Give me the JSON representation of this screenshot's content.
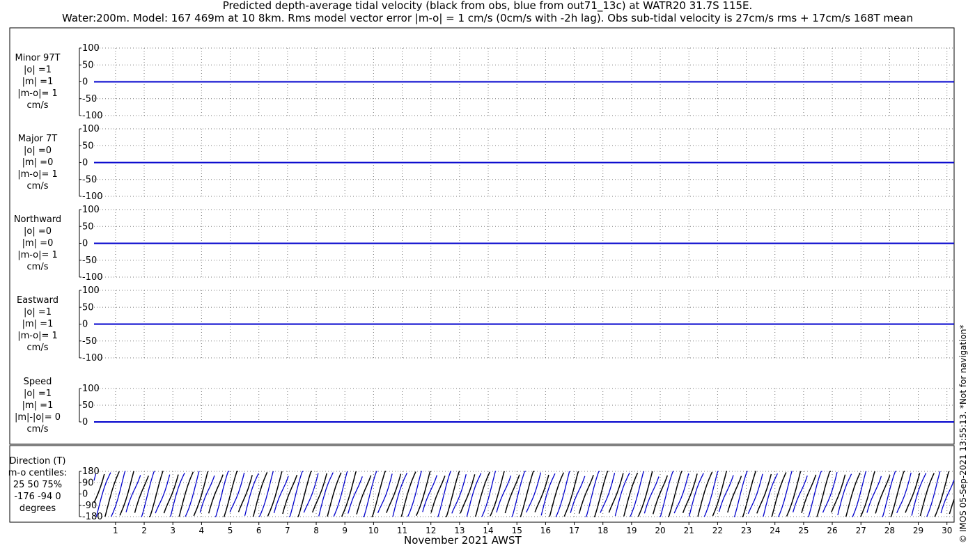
{
  "title": {
    "line1": "Predicted depth-average tidal velocity (black from obs, blue from out71_13c) at WATR20 31.7S 115E.",
    "line2": "Water:200m. Model: 167 469m at 10 8km. Rms model vector error |m-o| = 1 cm/s (0cm/s with -2h lag). Obs sub-tidal velocity is 27cm/s rms + 17cm/s 168T mean"
  },
  "xlabel": "November 2021 AWST",
  "credit": "© IMOS 05-Sep-2021 13:55:13. *Not for navigation*",
  "colors": {
    "obs": "#000000",
    "model": "#0000cc",
    "grid": "#777777"
  },
  "chart_data": {
    "type": "line",
    "x_ticks": [
      "1",
      "2",
      "3",
      "4",
      "5",
      "6",
      "7",
      "8",
      "9",
      "10",
      "11",
      "12",
      "13",
      "14",
      "15",
      "16",
      "17",
      "18",
      "19",
      "20",
      "21",
      "22",
      "23",
      "24",
      "25",
      "26",
      "27",
      "28",
      "29",
      "30"
    ],
    "xlim": [
      0.25,
      30.25
    ],
    "grid": true,
    "series_legend": {
      "obs": "black from obs",
      "model": "blue from out71_13c"
    },
    "panels": [
      {
        "id": "minor",
        "label_lines": [
          "Minor 97T",
          "|o| =1",
          "|m| =1",
          "|m-o|= 1",
          "cm/s"
        ],
        "y_ticks": [
          "100",
          "50",
          "0",
          "-50",
          "-100"
        ],
        "ylim": [
          -100,
          100
        ],
        "obs_value": 0,
        "model_value": 0
      },
      {
        "id": "major",
        "label_lines": [
          "Major 7T",
          "|o| =0",
          "|m| =0",
          "|m-o|= 1",
          "cm/s"
        ],
        "y_ticks": [
          "100",
          "50",
          "0",
          "-50",
          "-100"
        ],
        "ylim": [
          -100,
          100
        ],
        "obs_value": 0,
        "model_value": 0
      },
      {
        "id": "north",
        "label_lines": [
          "Northward",
          "|o| =0",
          "|m| =0",
          "|m-o|= 1",
          "cm/s"
        ],
        "y_ticks": [
          "100",
          "50",
          "0",
          "-50",
          "-100"
        ],
        "ylim": [
          -100,
          100
        ],
        "obs_value": 0,
        "model_value": 0
      },
      {
        "id": "east",
        "label_lines": [
          "Eastward",
          "|o| =1",
          "|m| =1",
          "|m-o|= 1",
          "cm/s"
        ],
        "y_ticks": [
          "100",
          "50",
          "0",
          "-50",
          "-100"
        ],
        "ylim": [
          -100,
          100
        ],
        "obs_value": 0,
        "model_value": 0
      },
      {
        "id": "speed",
        "label_lines": [
          "Speed",
          "|o| =1",
          "|m| =1",
          "|m|-|o|= 0",
          "cm/s"
        ],
        "y_ticks": [
          "100",
          "50",
          "0"
        ],
        "ylim": [
          0,
          100
        ],
        "obs_value": 0,
        "model_value": 0
      },
      {
        "id": "direction",
        "label_lines": [
          "Direction (T)",
          "m-o centiles:",
          "25  50  75%",
          "-176  -94    0",
          "degrees"
        ],
        "y_ticks": [
          "180",
          "90",
          "0",
          "-90",
          "-180"
        ],
        "ylim": [
          -180,
          180
        ],
        "tidal_period_days": 0.517
      }
    ]
  }
}
